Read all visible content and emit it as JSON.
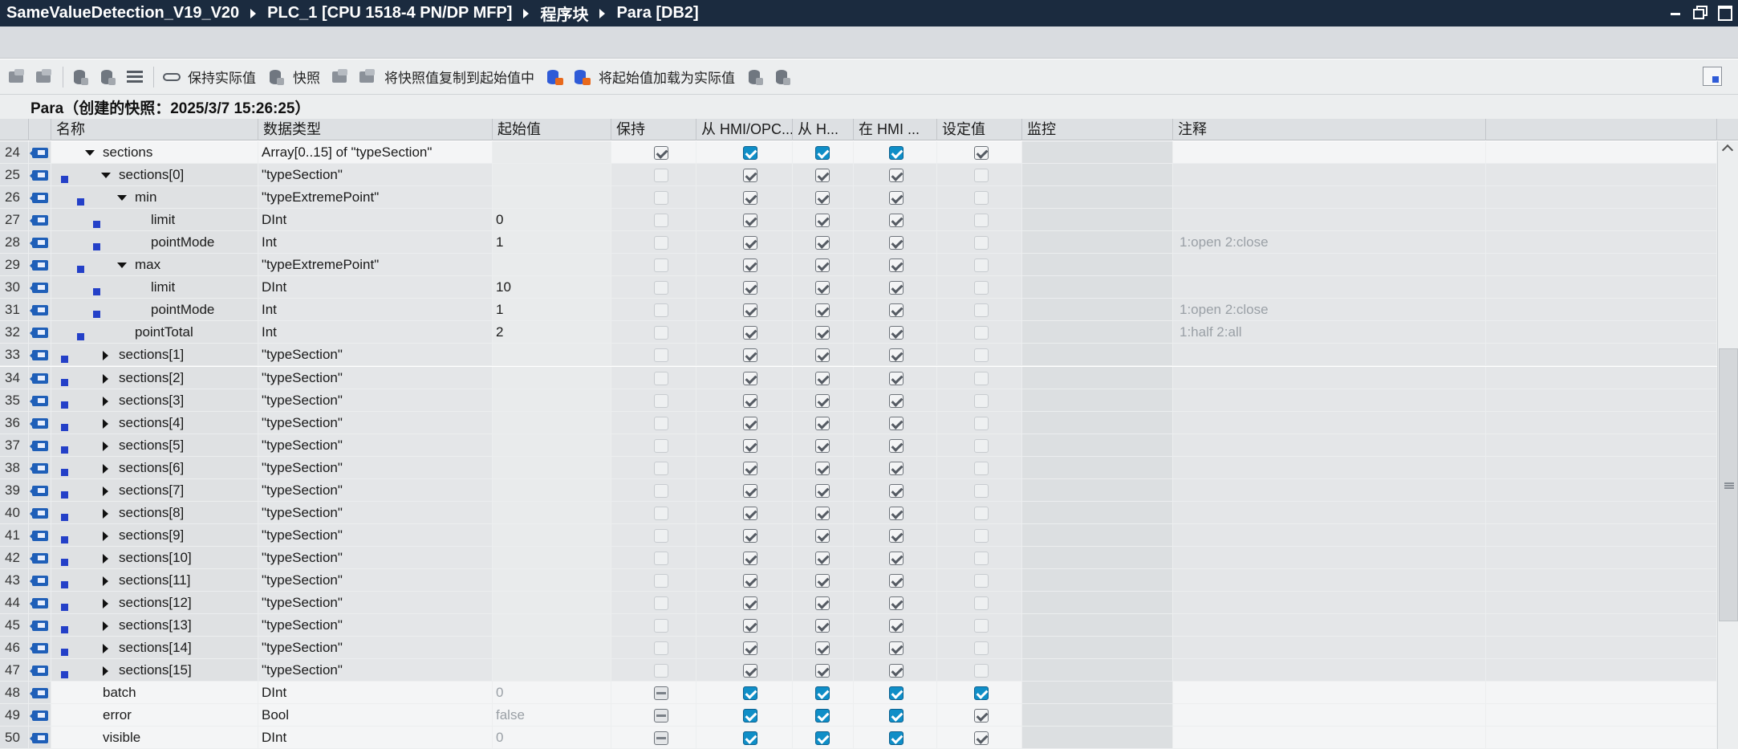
{
  "window": {
    "breadcrumb": [
      "SameValueDetection_V19_V20",
      "PLC_1 [CPU 1518-4 PN/DP MFP]",
      "程序块",
      "Para [DB2]"
    ]
  },
  "toolbar": {
    "keep_actual_label": "保持实际值",
    "snapshot_label": "快照",
    "copy_snapshot_label": "将快照值复制到起始值中",
    "load_start_label": "将起始值加载为实际值"
  },
  "info": {
    "title": "Para（创建的快照：2025/3/7 15:26:25）"
  },
  "columns": {
    "name": "名称",
    "datatype": "数据类型",
    "start": "起始值",
    "retain": "保持",
    "hmi_opc": "从 HMI/OPC...",
    "hmi_access": "从 H...",
    "hmi_visible": "在 HMI ...",
    "setpoint": "设定值",
    "monitor": "监控",
    "comment": "注释"
  },
  "rows": [
    {
      "no": "24",
      "name": "sections",
      "type": "Array[0..15] of \"typeSection\"",
      "start": "",
      "comment": "",
      "level": 1,
      "expander": "down",
      "bullet": false,
      "retain": "grey",
      "hmi1": true,
      "hmi2": true,
      "hmi3": true,
      "set": "grey",
      "style": "sel"
    },
    {
      "no": "25",
      "name": "sections[0]",
      "type": "\"typeSection\"",
      "start": "",
      "comment": "",
      "level": 2,
      "expander": "down",
      "bullet": true,
      "retain": "dim",
      "hmi1": "grey",
      "hmi2": "grey",
      "hmi3": "grey",
      "set": "dim",
      "style": "norm"
    },
    {
      "no": "26",
      "name": "min",
      "type": "\"typeExtremePoint\"",
      "start": "",
      "comment": "",
      "level": 3,
      "expander": "down",
      "bullet": true,
      "retain": "dim",
      "hmi1": "grey",
      "hmi2": "grey",
      "hmi3": "grey",
      "set": "dim",
      "style": "norm"
    },
    {
      "no": "27",
      "name": "limit",
      "type": "DInt",
      "start": "0",
      "comment": "",
      "level": 4,
      "expander": "",
      "bullet": true,
      "retain": "dim",
      "hmi1": "grey",
      "hmi2": "grey",
      "hmi3": "grey",
      "set": "dim",
      "style": "norm"
    },
    {
      "no": "28",
      "name": "pointMode",
      "type": "Int",
      "start": "1",
      "comment": "1:open 2:close",
      "level": 4,
      "expander": "",
      "bullet": true,
      "retain": "dim",
      "hmi1": "grey",
      "hmi2": "grey",
      "hmi3": "grey",
      "set": "dim",
      "style": "norm"
    },
    {
      "no": "29",
      "name": "max",
      "type": "\"typeExtremePoint\"",
      "start": "",
      "comment": "",
      "level": 3,
      "expander": "down",
      "bullet": true,
      "retain": "dim",
      "hmi1": "grey",
      "hmi2": "grey",
      "hmi3": "grey",
      "set": "dim",
      "style": "norm"
    },
    {
      "no": "30",
      "name": "limit",
      "type": "DInt",
      "start": "10",
      "comment": "",
      "level": 4,
      "expander": "",
      "bullet": true,
      "retain": "dim",
      "hmi1": "grey",
      "hmi2": "grey",
      "hmi3": "grey",
      "set": "dim",
      "style": "norm"
    },
    {
      "no": "31",
      "name": "pointMode",
      "type": "Int",
      "start": "1",
      "comment": "1:open 2:close",
      "level": 4,
      "expander": "",
      "bullet": true,
      "retain": "dim",
      "hmi1": "grey",
      "hmi2": "grey",
      "hmi3": "grey",
      "set": "dim",
      "style": "norm"
    },
    {
      "no": "32",
      "name": "pointTotal",
      "type": "Int",
      "start": "2",
      "comment": "1:half 2:all",
      "level": 3,
      "expander": "",
      "bullet": true,
      "retain": "dim",
      "hmi1": "grey",
      "hmi2": "grey",
      "hmi3": "grey",
      "set": "dim",
      "style": "norm"
    },
    {
      "no": "33",
      "name": "sections[1]",
      "type": "\"typeSection\"",
      "start": "",
      "comment": "",
      "level": 2,
      "expander": "right",
      "bullet": true,
      "retain": "dim",
      "hmi1": "grey",
      "hmi2": "grey",
      "hmi3": "grey",
      "set": "dim",
      "style": "norm"
    },
    {
      "no": "34",
      "name": "sections[2]",
      "type": "\"typeSection\"",
      "start": "",
      "comment": "",
      "level": 2,
      "expander": "right",
      "bullet": true,
      "retain": "dim",
      "hmi1": "grey",
      "hmi2": "grey",
      "hmi3": "grey",
      "set": "dim",
      "style": "norm"
    },
    {
      "no": "35",
      "name": "sections[3]",
      "type": "\"typeSection\"",
      "start": "",
      "comment": "",
      "level": 2,
      "expander": "right",
      "bullet": true,
      "retain": "dim",
      "hmi1": "grey",
      "hmi2": "grey",
      "hmi3": "grey",
      "set": "dim",
      "style": "norm"
    },
    {
      "no": "36",
      "name": "sections[4]",
      "type": "\"typeSection\"",
      "start": "",
      "comment": "",
      "level": 2,
      "expander": "right",
      "bullet": true,
      "retain": "dim",
      "hmi1": "grey",
      "hmi2": "grey",
      "hmi3": "grey",
      "set": "dim",
      "style": "norm"
    },
    {
      "no": "37",
      "name": "sections[5]",
      "type": "\"typeSection\"",
      "start": "",
      "comment": "",
      "level": 2,
      "expander": "right",
      "bullet": true,
      "retain": "dim",
      "hmi1": "grey",
      "hmi2": "grey",
      "hmi3": "grey",
      "set": "dim",
      "style": "norm"
    },
    {
      "no": "38",
      "name": "sections[6]",
      "type": "\"typeSection\"",
      "start": "",
      "comment": "",
      "level": 2,
      "expander": "right",
      "bullet": true,
      "retain": "dim",
      "hmi1": "grey",
      "hmi2": "grey",
      "hmi3": "grey",
      "set": "dim",
      "style": "norm"
    },
    {
      "no": "39",
      "name": "sections[7]",
      "type": "\"typeSection\"",
      "start": "",
      "comment": "",
      "level": 2,
      "expander": "right",
      "bullet": true,
      "retain": "dim",
      "hmi1": "grey",
      "hmi2": "grey",
      "hmi3": "grey",
      "set": "dim",
      "style": "norm"
    },
    {
      "no": "40",
      "name": "sections[8]",
      "type": "\"typeSection\"",
      "start": "",
      "comment": "",
      "level": 2,
      "expander": "right",
      "bullet": true,
      "retain": "dim",
      "hmi1": "grey",
      "hmi2": "grey",
      "hmi3": "grey",
      "set": "dim",
      "style": "norm"
    },
    {
      "no": "41",
      "name": "sections[9]",
      "type": "\"typeSection\"",
      "start": "",
      "comment": "",
      "level": 2,
      "expander": "right",
      "bullet": true,
      "retain": "dim",
      "hmi1": "grey",
      "hmi2": "grey",
      "hmi3": "grey",
      "set": "dim",
      "style": "norm"
    },
    {
      "no": "42",
      "name": "sections[10]",
      "type": "\"typeSection\"",
      "start": "",
      "comment": "",
      "level": 2,
      "expander": "right",
      "bullet": true,
      "retain": "dim",
      "hmi1": "grey",
      "hmi2": "grey",
      "hmi3": "grey",
      "set": "dim",
      "style": "norm"
    },
    {
      "no": "43",
      "name": "sections[11]",
      "type": "\"typeSection\"",
      "start": "",
      "comment": "",
      "level": 2,
      "expander": "right",
      "bullet": true,
      "retain": "dim",
      "hmi1": "grey",
      "hmi2": "grey",
      "hmi3": "grey",
      "set": "dim",
      "style": "norm"
    },
    {
      "no": "44",
      "name": "sections[12]",
      "type": "\"typeSection\"",
      "start": "",
      "comment": "",
      "level": 2,
      "expander": "right",
      "bullet": true,
      "retain": "dim",
      "hmi1": "grey",
      "hmi2": "grey",
      "hmi3": "grey",
      "set": "dim",
      "style": "norm"
    },
    {
      "no": "45",
      "name": "sections[13]",
      "type": "\"typeSection\"",
      "start": "",
      "comment": "",
      "level": 2,
      "expander": "right",
      "bullet": true,
      "retain": "dim",
      "hmi1": "grey",
      "hmi2": "grey",
      "hmi3": "grey",
      "set": "dim",
      "style": "norm"
    },
    {
      "no": "46",
      "name": "sections[14]",
      "type": "\"typeSection\"",
      "start": "",
      "comment": "",
      "level": 2,
      "expander": "right",
      "bullet": true,
      "retain": "dim",
      "hmi1": "grey",
      "hmi2": "grey",
      "hmi3": "grey",
      "set": "dim",
      "style": "norm"
    },
    {
      "no": "47",
      "name": "sections[15]",
      "type": "\"typeSection\"",
      "start": "",
      "comment": "",
      "level": 2,
      "expander": "right",
      "bullet": true,
      "retain": "dim",
      "hmi1": "grey",
      "hmi2": "grey",
      "hmi3": "grey",
      "set": "dim",
      "style": "norm"
    },
    {
      "no": "48",
      "name": "batch",
      "type": "DInt",
      "start": "0",
      "comment": "",
      "level": 1,
      "expander": "",
      "bullet": false,
      "retain": "dgrey",
      "hmi1": true,
      "hmi2": true,
      "hmi3": true,
      "set": true,
      "style": "lite"
    },
    {
      "no": "49",
      "name": "error",
      "type": "Bool",
      "start": "false",
      "comment": "",
      "level": 1,
      "expander": "",
      "bullet": false,
      "retain": "dgrey",
      "hmi1": true,
      "hmi2": true,
      "hmi3": true,
      "set": "grey",
      "style": "lite"
    },
    {
      "no": "50",
      "name": "visible",
      "type": "DInt",
      "start": "0",
      "comment": "",
      "level": 1,
      "expander": "",
      "bullet": false,
      "retain": "dgrey",
      "hmi1": true,
      "hmi2": true,
      "hmi3": true,
      "set": "grey",
      "style": "lite"
    }
  ],
  "colors": {
    "titlebar": "#1b2b3f",
    "checkbox_on": "#0f8ec7",
    "member_bullet": "#2440c8",
    "db_icon": "#1f5fb8"
  }
}
